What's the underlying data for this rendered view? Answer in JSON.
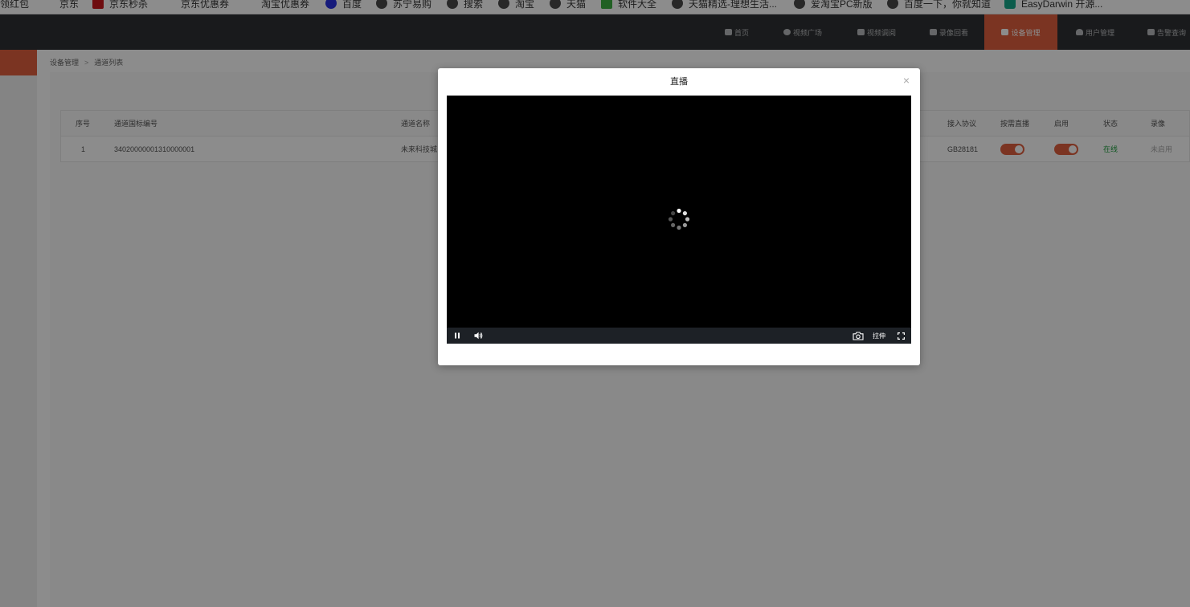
{
  "bookmarks": [
    {
      "label": "领红包",
      "icon": "none"
    },
    {
      "label": "京东",
      "icon": "none"
    },
    {
      "label": "京东秒杀",
      "icon": "jd-icon"
    },
    {
      "label": "京东优惠券",
      "icon": "none"
    },
    {
      "label": "淘宝优惠券",
      "icon": "none"
    },
    {
      "label": "百度",
      "icon": "baidu-icon"
    },
    {
      "label": "苏宁易购",
      "icon": "globe-icon"
    },
    {
      "label": "搜索",
      "icon": "globe-icon"
    },
    {
      "label": "淘宝",
      "icon": "globe-icon"
    },
    {
      "label": "天猫",
      "icon": "globe-icon"
    },
    {
      "label": "软件大全",
      "icon": "download-icon"
    },
    {
      "label": "天猫精选-理想生活...",
      "icon": "globe-icon"
    },
    {
      "label": "爱淘宝PC新版",
      "icon": "globe-icon"
    },
    {
      "label": "百度一下，你就知道",
      "icon": "globe-icon"
    },
    {
      "label": "EasyDarwin 开源...",
      "icon": "easydarwin-icon"
    }
  ],
  "nav": {
    "items": [
      {
        "label": "首页",
        "icon": "home-icon"
      },
      {
        "label": "视频广场",
        "icon": "play-circle-icon"
      },
      {
        "label": "视频调阅",
        "icon": "grid-icon"
      },
      {
        "label": "录像回看",
        "icon": "video-camera-icon"
      },
      {
        "label": "设备管理",
        "icon": "device-icon",
        "active": true
      },
      {
        "label": "用户管理",
        "icon": "user-icon"
      },
      {
        "label": "告警查询",
        "icon": "alarm-icon"
      }
    ]
  },
  "breadcrumb": {
    "parent": "设备管理",
    "separator": ">",
    "current": "通道列表"
  },
  "table": {
    "headers": {
      "index": "序号",
      "gb_code": "通道国标编号",
      "name": "通道名称",
      "protocol": "接入协议",
      "on_demand": "按需直播",
      "enabled": "启用",
      "status": "状态",
      "recording": "录像"
    },
    "rows": [
      {
        "index": "1",
        "gb_code": "34020000001310000001",
        "name": "未来科技城",
        "protocol": "GB28181",
        "on_demand": true,
        "enabled": true,
        "status": "在线",
        "recording": "未启用"
      }
    ]
  },
  "modal": {
    "title": "直播",
    "close_glyph": "×",
    "controls": {
      "stretch_label": "拉伸"
    }
  },
  "colors": {
    "accent": "#e0603f",
    "nav_bg": "#2f3133",
    "online": "#1a9c3a"
  }
}
